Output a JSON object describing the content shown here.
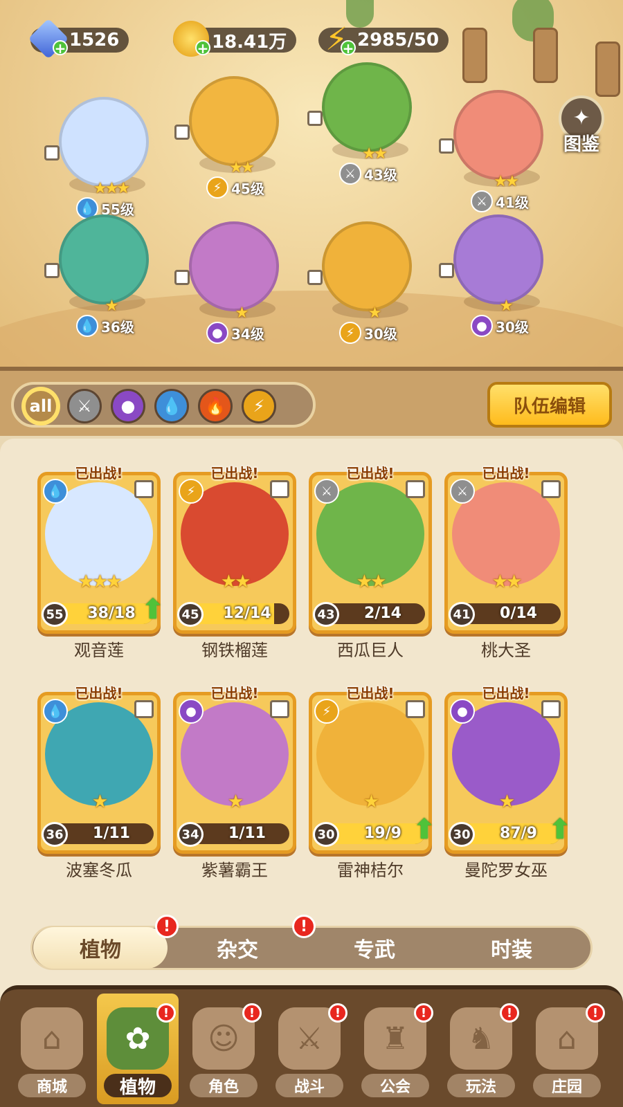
{
  "resources": {
    "gems": "1526",
    "coins": "18.41万",
    "energy": "2985/50"
  },
  "atlas_label": "图鉴",
  "heroes": [
    {
      "level": "55级",
      "stars": "★★★",
      "element": "water",
      "color": "#cfe2ff"
    },
    {
      "level": "45级",
      "stars": "★★",
      "element": "lightning",
      "color": "#f2b640"
    },
    {
      "level": "43级",
      "stars": "★★",
      "element": "sword",
      "color": "#6fb54a"
    },
    {
      "level": "41级",
      "stars": "★★",
      "element": "sword",
      "color": "#f08c78"
    },
    {
      "level": "36级",
      "stars": "★",
      "element": "water",
      "color": "#4fb59a"
    },
    {
      "level": "34级",
      "stars": "★",
      "element": "poison",
      "color": "#c27ac7"
    },
    {
      "level": "30级",
      "stars": "★",
      "element": "lightning",
      "color": "#f0b23a"
    },
    {
      "level": "30级",
      "stars": "★",
      "element": "poison",
      "color": "#a77bd6"
    }
  ],
  "filters": [
    {
      "name": "all",
      "label": "all",
      "color": "#b48a4a"
    },
    {
      "name": "sword",
      "label": "⚔",
      "color": "#8f8f8f"
    },
    {
      "name": "poison",
      "label": "●",
      "color": "#8a49c4"
    },
    {
      "name": "water",
      "label": "💧",
      "color": "#3e8fd9"
    },
    {
      "name": "fire",
      "label": "🔥",
      "color": "#e4561a"
    },
    {
      "name": "lightning",
      "label": "⚡",
      "color": "#e9a41a"
    }
  ],
  "team_edit_label": "队伍编辑",
  "cards": [
    {
      "tag": "已出战!",
      "name": "观音莲",
      "level": "55",
      "progress": "38/18",
      "fill": 1.0,
      "stars": "★★★",
      "upgrade": true,
      "elem_icon": "💧",
      "elem_color": "#3e8fd9",
      "art": "#d8e8ff"
    },
    {
      "tag": "已出战!",
      "name": "钢铁榴莲",
      "level": "45",
      "progress": "12/14",
      "fill": 0.86,
      "stars": "★★",
      "upgrade": false,
      "elem_icon": "⚡",
      "elem_color": "#e9a41a",
      "art": "#d94a30"
    },
    {
      "tag": "已出战!",
      "name": "西瓜巨人",
      "level": "43",
      "progress": "2/14",
      "fill": 0.14,
      "stars": "★★",
      "upgrade": false,
      "elem_icon": "⚔",
      "elem_color": "#8f8f8f",
      "art": "#6fb54a"
    },
    {
      "tag": "已出战!",
      "name": "桃大圣",
      "level": "41",
      "progress": "0/14",
      "fill": 0.0,
      "stars": "★★",
      "upgrade": false,
      "elem_icon": "⚔",
      "elem_color": "#8f8f8f",
      "art": "#f08c78"
    },
    {
      "tag": "已出战!",
      "name": "波塞冬瓜",
      "level": "36",
      "progress": "1/11",
      "fill": 0.09,
      "stars": "★",
      "upgrade": false,
      "elem_icon": "💧",
      "elem_color": "#3e8fd9",
      "art": "#3fa7b2"
    },
    {
      "tag": "已出战!",
      "name": "紫薯霸王",
      "level": "34",
      "progress": "1/11",
      "fill": 0.09,
      "stars": "★",
      "upgrade": false,
      "elem_icon": "●",
      "elem_color": "#8a49c4",
      "art": "#c27ac7"
    },
    {
      "tag": "已出战!",
      "name": "雷神桔尔",
      "level": "30",
      "progress": "19/9",
      "fill": 1.0,
      "stars": "★",
      "upgrade": true,
      "elem_icon": "⚡",
      "elem_color": "#e9a41a",
      "art": "#f0b23a"
    },
    {
      "tag": "已出战!",
      "name": "曼陀罗女巫",
      "level": "30",
      "progress": "87/9",
      "fill": 1.0,
      "stars": "★",
      "upgrade": true,
      "elem_icon": "●",
      "elem_color": "#8a49c4",
      "art": "#9a5bc9"
    }
  ],
  "subtabs": [
    {
      "label": "植物",
      "active": true,
      "alert": true
    },
    {
      "label": "杂交",
      "active": false,
      "alert": true
    },
    {
      "label": "专武",
      "active": false,
      "alert": false
    },
    {
      "label": "时装",
      "active": false,
      "alert": false
    }
  ],
  "alert_mark": "!",
  "nav": [
    {
      "label": "商城",
      "active": false,
      "alert": false,
      "icon": "shop-icon",
      "glyph": "⌂"
    },
    {
      "label": "植物",
      "active": true,
      "alert": true,
      "icon": "plants-icon",
      "glyph": "✿"
    },
    {
      "label": "角色",
      "active": false,
      "alert": true,
      "icon": "character-icon",
      "glyph": "☺"
    },
    {
      "label": "战斗",
      "active": false,
      "alert": true,
      "icon": "battle-icon",
      "glyph": "⚔"
    },
    {
      "label": "公会",
      "active": false,
      "alert": true,
      "icon": "guild-icon",
      "glyph": "♜"
    },
    {
      "label": "玩法",
      "active": false,
      "alert": true,
      "icon": "gameplay-icon",
      "glyph": "♞"
    },
    {
      "label": "庄园",
      "active": false,
      "alert": true,
      "icon": "manor-icon",
      "glyph": "⌂"
    }
  ]
}
